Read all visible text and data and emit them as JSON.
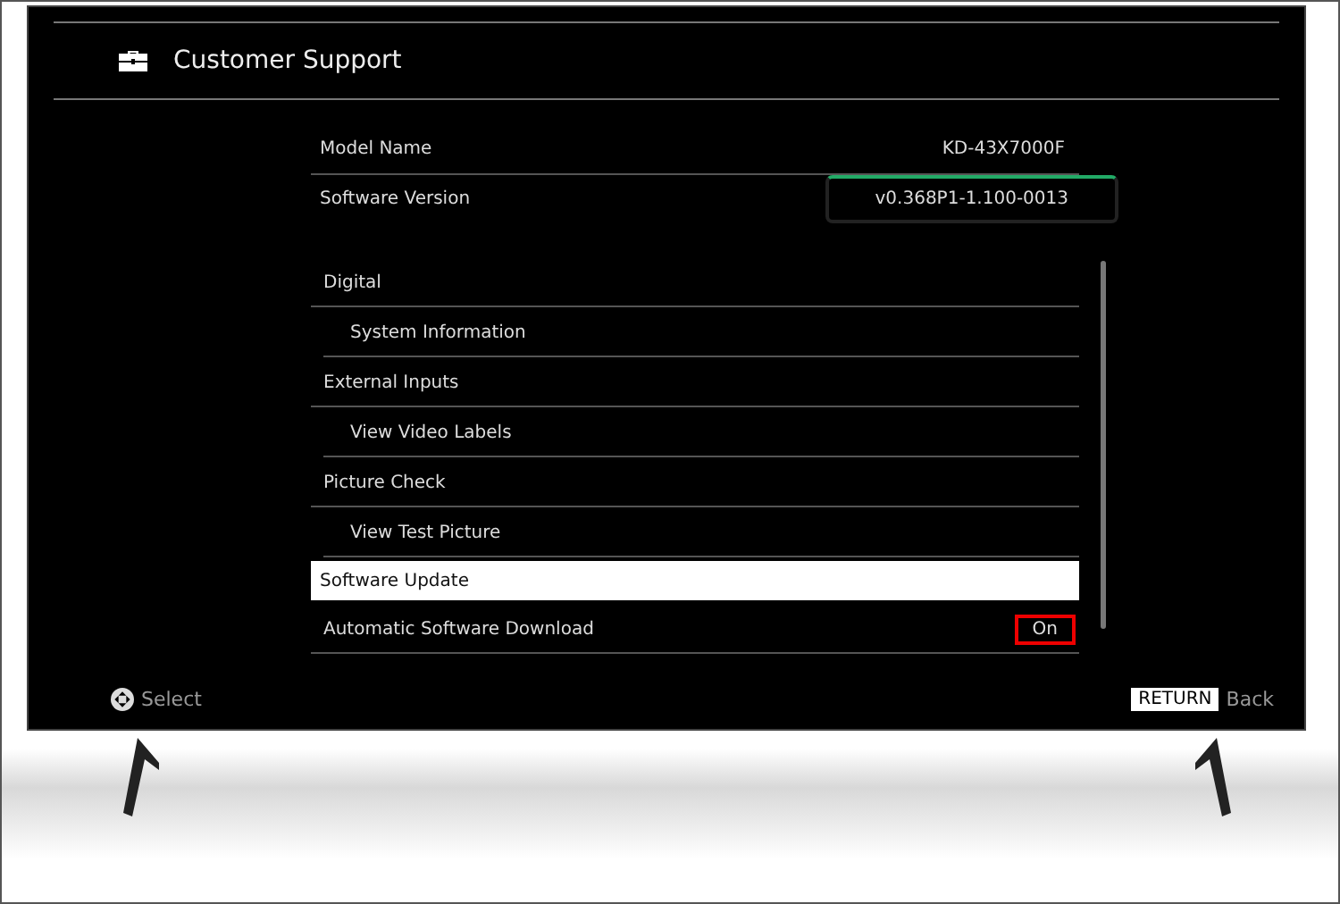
{
  "header": {
    "title": "Customer Support"
  },
  "info": [
    {
      "label": "Model Name",
      "value": "KD-43X7000F",
      "kind": "plain"
    },
    {
      "label": "Software Version",
      "value": "v0.368P1-1.100-0013",
      "kind": "boxed"
    }
  ],
  "menu": [
    {
      "label": "Digital",
      "selected": false,
      "children": [
        {
          "label": "System Information",
          "selected": false
        }
      ]
    },
    {
      "label": "External Inputs",
      "selected": false,
      "children": [
        {
          "label": "View Video Labels",
          "selected": false
        }
      ]
    },
    {
      "label": "Picture Check",
      "selected": false,
      "children": [
        {
          "label": "View Test Picture",
          "selected": false
        }
      ]
    },
    {
      "label": "Software Update",
      "selected": true
    },
    {
      "label": "Automatic Software Download",
      "selected": false,
      "value": "On",
      "highlighted": true
    }
  ],
  "footer": [
    {
      "kind": "dpad",
      "label": "Select"
    },
    {
      "kind": "key",
      "key": "RETURN",
      "label": "Back"
    }
  ]
}
